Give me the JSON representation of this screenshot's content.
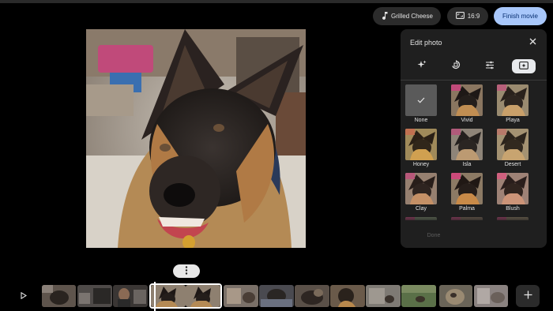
{
  "topbar": {
    "music_label": "Grilled Cheese",
    "aspect_label": "16:9",
    "finish_label": "Finish movie"
  },
  "panel": {
    "title": "Edit photo",
    "tabs": [
      {
        "name": "auto-enhance",
        "active": false
      },
      {
        "name": "rotate-crop",
        "active": false
      },
      {
        "name": "adjust",
        "active": false
      },
      {
        "name": "filters",
        "active": true
      }
    ],
    "filters": [
      {
        "label": "None",
        "selected": true
      },
      {
        "label": "Vivid"
      },
      {
        "label": "Playa"
      },
      {
        "label": "Honey"
      },
      {
        "label": "Isla"
      },
      {
        "label": "Desert"
      },
      {
        "label": "Clay"
      },
      {
        "label": "Palma"
      },
      {
        "label": "Blush"
      }
    ],
    "apply_label": "Done"
  },
  "colors": {
    "accent": "#a8c7fa",
    "panel_bg": "#1f1f1f",
    "button_bg": "#2b2b2b"
  }
}
